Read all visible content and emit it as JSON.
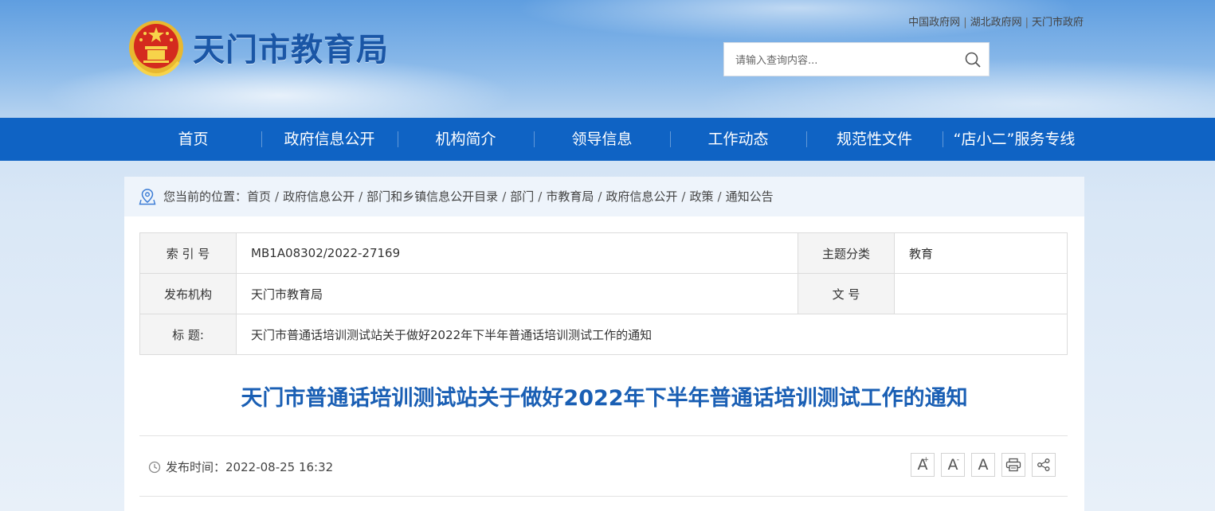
{
  "header": {
    "site_title": "天门市教育局",
    "top_links": [
      "中国政府网",
      "湖北政府网",
      "天门市政府"
    ],
    "search_placeholder": "请输入查询内容..."
  },
  "nav": {
    "items": [
      "首页",
      "政府信息公开",
      "机构简介",
      "领导信息",
      "工作动态",
      "规范性文件",
      "“店小二”服务专线"
    ]
  },
  "breadcrumb": {
    "prefix": "您当前的位置：",
    "items": [
      "首页",
      "政府信息公开",
      "部门和乡镇信息公开目录",
      "部门",
      "市教育局",
      "政府信息公开",
      "政策",
      "通知公告"
    ]
  },
  "meta": {
    "index_label": "索 引 号",
    "index_value": "MB1A08302/2022-27169",
    "topic_label": "主题分类",
    "topic_value": "教育",
    "publisher_label": "发布机构",
    "publisher_value": "天门市教育局",
    "docno_label": "文 号",
    "docno_value": "",
    "title_label": "标 题:",
    "title_value": "天门市普通话培训测试站关于做好2022年下半年普通话培训测试工作的通知"
  },
  "article": {
    "title": "天门市普通话培训测试站关于做好2022年下半年普通话培训测试工作的通知",
    "publish_label": "发布时间：",
    "publish_time": "2022-08-25 16:32"
  },
  "tools": {
    "font_increase": "A",
    "font_decrease": "A",
    "font_reset": "A",
    "plus_mark": "+",
    "minus_mark": "-"
  },
  "colors": {
    "nav_bg": "#0f63c4",
    "title_blue": "#1a5fb4",
    "site_title_blue": "#1a56a6"
  }
}
